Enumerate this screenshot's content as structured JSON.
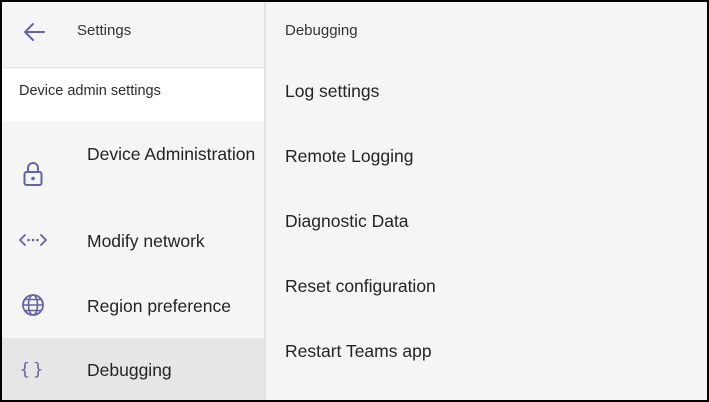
{
  "left_panel": {
    "header": {
      "title": "Settings",
      "back_icon": "arrow-left-icon"
    },
    "section_label": "Device admin settings",
    "items": [
      {
        "label": "Device Administration",
        "icon": "lock-icon",
        "active": false
      },
      {
        "label": "Modify network",
        "icon": "network-code-icon",
        "active": false
      },
      {
        "label": "Region preference",
        "icon": "globe-icon",
        "active": false
      },
      {
        "label": "Debugging",
        "icon": "braces-icon",
        "active": true
      }
    ]
  },
  "right_panel": {
    "header": "Debugging",
    "items": [
      {
        "label": "Log settings"
      },
      {
        "label": "Remote Logging"
      },
      {
        "label": "Diagnostic Data"
      },
      {
        "label": "Reset configuration"
      },
      {
        "label": "Restart Teams app"
      }
    ]
  },
  "colors": {
    "accent": "#6264a7",
    "background": "#f5f5f5",
    "active_item": "#e6e6e6",
    "section_bg": "#ffffff"
  }
}
